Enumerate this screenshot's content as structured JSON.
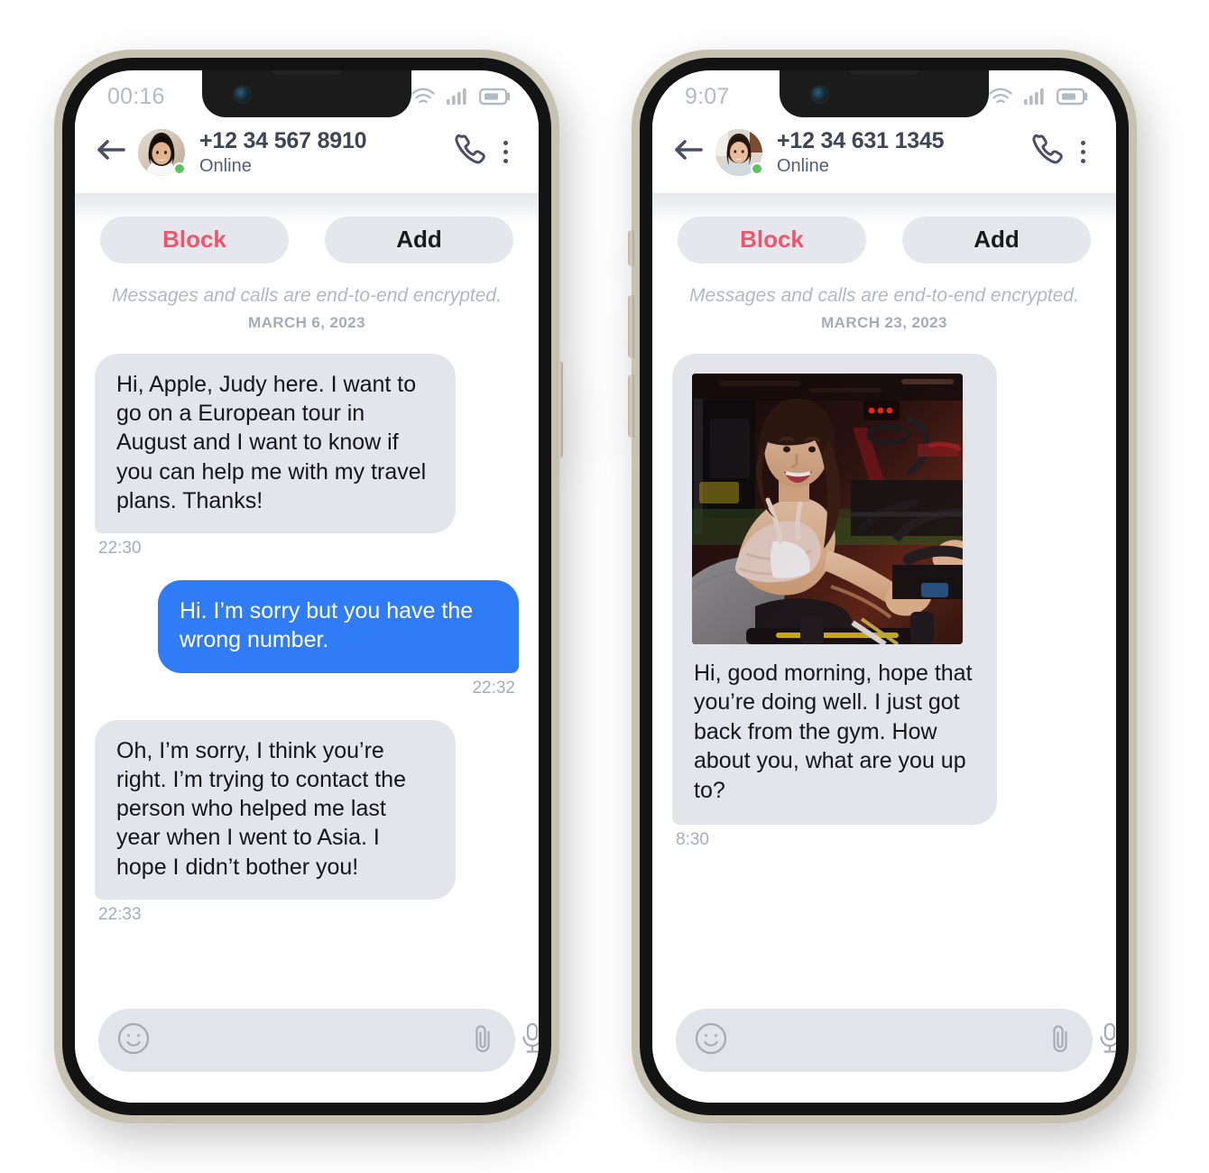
{
  "phones": [
    {
      "id": "phone-left",
      "status": {
        "clock": "00:16",
        "wifi_icon": "wifi-icon",
        "signal_icon": "cellular-signal-icon",
        "battery_icon": "battery-icon"
      },
      "header": {
        "back_icon": "back-arrow-icon",
        "avatar_name": "contact-avatar",
        "peer_name": "+12 34 567 8910",
        "peer_status": "Online",
        "call_icon": "phone-call-icon",
        "menu_icon": "kebab-menu-icon"
      },
      "actions": {
        "block_label": "Block",
        "add_label": "Add"
      },
      "encryption_notice": "Messages and calls are end-to-end encrypted.",
      "date_divider": "MARCH 6, 2023",
      "messages": [
        {
          "direction": "in",
          "text": "Hi, Apple, Judy here. I want to go on a European tour in August and I want to know if you can help me with my travel plans. Thanks!",
          "time": "22:30",
          "has_photo": false
        },
        {
          "direction": "out",
          "text": "Hi. I’m sorry but you have the wrong number.",
          "time": "22:32",
          "has_photo": false
        },
        {
          "direction": "in",
          "text": "Oh, I’m sorry, I think you’re right. I’m trying to contact the person who helped me last year when I went to Asia. I hope I didn’t bother you!",
          "time": "22:33",
          "has_photo": false
        }
      ],
      "composer": {
        "placeholder": "",
        "value": "",
        "emoji_icon": "emoji-smiley-icon",
        "attach_icon": "paperclip-icon",
        "mic_icon": "microphone-icon"
      }
    },
    {
      "id": "phone-right",
      "status": {
        "clock": "9:07",
        "wifi_icon": "wifi-icon",
        "signal_icon": "cellular-signal-icon",
        "battery_icon": "battery-icon"
      },
      "header": {
        "back_icon": "back-arrow-icon",
        "avatar_name": "contact-avatar",
        "peer_name": "+12 34 631 1345",
        "peer_status": "Online",
        "call_icon": "phone-call-icon",
        "menu_icon": "kebab-menu-icon"
      },
      "actions": {
        "block_label": "Block",
        "add_label": "Add"
      },
      "encryption_notice": "Messages and calls are end-to-end encrypted.",
      "date_divider": "MARCH 23, 2023",
      "messages": [
        {
          "direction": "in",
          "text": "Hi, good morning, hope that you’re doing well. I just got back from the gym. How about you, what are you up to?",
          "time": "8:30",
          "has_photo": true,
          "photo_alt": "woman-on-exercise-bike-at-gym"
        }
      ],
      "composer": {
        "placeholder": "",
        "value": "",
        "emoji_icon": "emoji-smiley-icon",
        "attach_icon": "paperclip-icon",
        "mic_icon": "microphone-icon"
      }
    }
  ],
  "colors": {
    "outgoing_bubble": "#2f7cf6",
    "incoming_bubble": "#e3e5eb",
    "block_text": "#f2556b",
    "online_dot": "#5dc263",
    "bezel": "#c7c1b2",
    "frame": "#131313",
    "muted_text": "#a7abb6"
  }
}
